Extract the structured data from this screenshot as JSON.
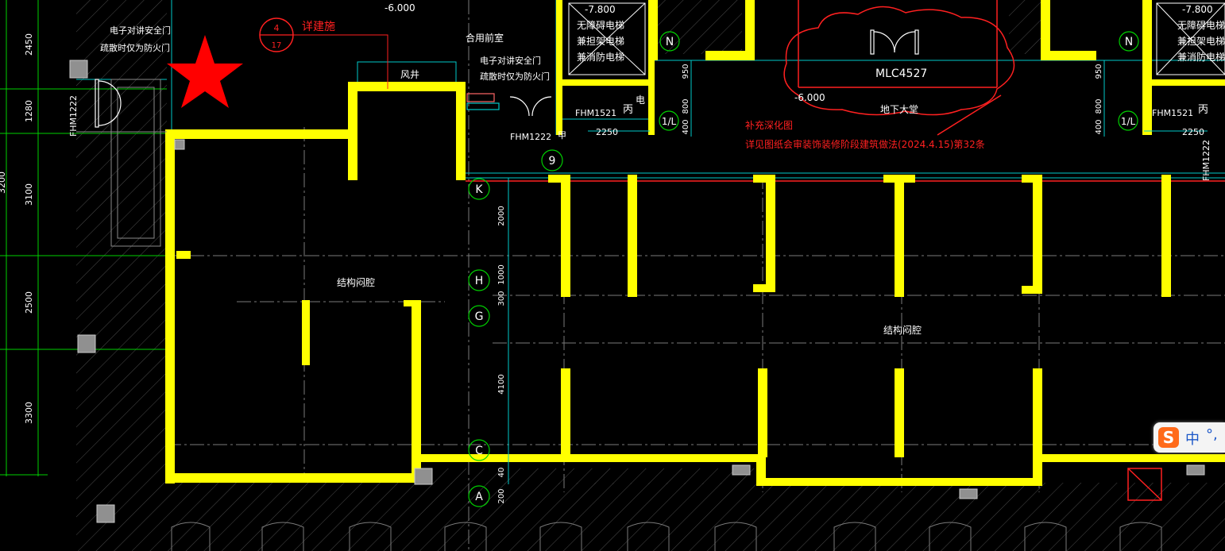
{
  "colors": {
    "background": "#000000",
    "wall": "#ffff00",
    "red": "#ff2020",
    "white": "#ffffff",
    "green": "#00d000",
    "cyan": "#00c8c8",
    "hatch": "#505050",
    "ime_orange": "#ff6a1a"
  },
  "dimensions_left": [
    "2450",
    "1280",
    "3100",
    "2500",
    "3300"
  ],
  "dimension_left_partial": "3200",
  "axes": {
    "K": "K",
    "H": "H",
    "G": "G",
    "C": "C",
    "A": "A",
    "N1": "N",
    "N2": "N",
    "L1": "1/L",
    "L2": "1/L",
    "nine": "9"
  },
  "dims_mid": [
    "2000",
    "1000",
    "300",
    "4100",
    "40",
    "200"
  ],
  "dims_right": [
    "950",
    "800",
    "400"
  ],
  "dims_right2": [
    "950",
    "800",
    "400"
  ],
  "labels": {
    "elevation_neg6_top": "-6.000",
    "elevation_neg7_8_a": "-7.800",
    "elevation_neg7_8_b": "-7.800",
    "elevation_neg6_lobby": "-6.000",
    "detail_circle_num": "4",
    "detail_circle_den": "17",
    "detail_note": "详建施",
    "door_note_left_1": "电子对讲安全门",
    "door_note_left_2": "疏散时仅为防火门",
    "door_note_mid_title": "合用前室",
    "door_note_mid_1": "电子对讲安全门",
    "door_note_mid_2": "疏散时仅为防火门",
    "air_shaft": "风井",
    "elevator_a_1": "无障碍电梯",
    "elevator_a_2": "兼担架电梯",
    "elevator_a_3": "兼消防电梯",
    "elevator_b_1": "无障碍电梯",
    "elevator_b_2": "兼担架电梯",
    "elevator_b_3": "兼消防电梯",
    "fhm1222_left": "FHM1222",
    "fhm1222_mid": "FHM1222",
    "fhm1222_right": "FHM1222",
    "fhm1521_a": "FHM1521",
    "fhm1521_b": "FHM1521",
    "bing_a": "丙",
    "bing_b": "丙",
    "dian_a": "电",
    "jia": "甲",
    "dim_2250_a": "2250",
    "dim_2250_b": "2250",
    "mlc": "MLC4527",
    "lobby": "地下大堂",
    "supplement_title": "补充深化图",
    "supplement_note": "详见图纸会审装饰装修阶段建筑做法(2024.4.15)第32条",
    "cavity_left": "结构闷腔",
    "cavity_right": "结构闷腔"
  },
  "ime": {
    "logo": "S",
    "lang": "中",
    "punct": "°,"
  }
}
